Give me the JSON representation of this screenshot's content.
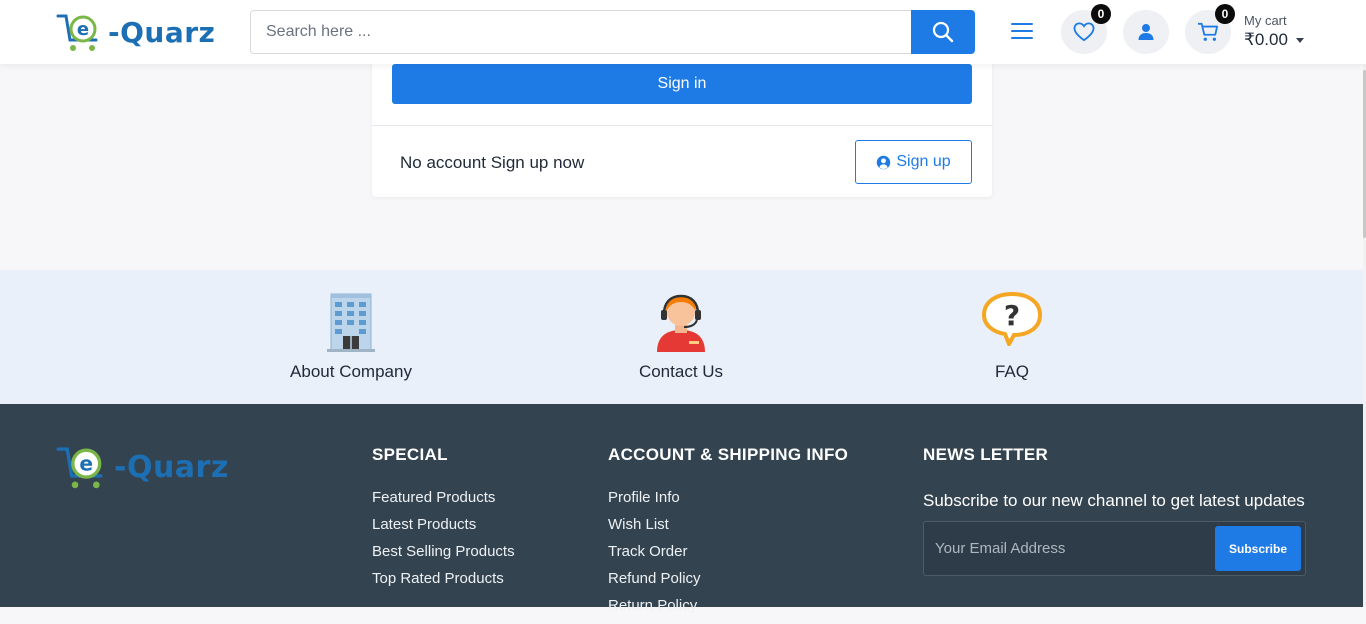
{
  "header": {
    "logo_text": "-Quarz",
    "logo_letter": "e",
    "search": {
      "placeholder": "Search here ..."
    },
    "wishlist_count": "0",
    "cart_count": "0",
    "cart_label": "My cart",
    "cart_total": "₹0.00"
  },
  "auth": {
    "signin_label": "Sign in",
    "no_account_text": "No account Sign up now",
    "signup_label": "Sign up"
  },
  "info": {
    "items": [
      {
        "label": "About Company",
        "icon": "building-icon"
      },
      {
        "label": "Contact Us",
        "icon": "support-agent-icon"
      },
      {
        "label": "FAQ",
        "icon": "question-bubble-icon"
      }
    ]
  },
  "footer": {
    "logo_text": "-Quarz",
    "logo_letter": "e",
    "special": {
      "title": "SPECIAL",
      "items": [
        "Featured Products",
        "Latest Products",
        "Best Selling Products",
        "Top Rated Products"
      ]
    },
    "account": {
      "title": "ACCOUNT & SHIPPING INFO",
      "items": [
        "Profile Info",
        "Wish List",
        "Track Order",
        "Refund Policy",
        "Return Policy"
      ]
    },
    "newsletter": {
      "title": "NEWS LETTER",
      "subtitle": "Subscribe to our new channel to get latest updates",
      "email_placeholder": "Your Email Address",
      "subscribe_label": "Subscribe"
    }
  },
  "colors": {
    "accent": "#1e7be6",
    "footer_bg": "#33434f",
    "info_band_bg": "#e9f0fa",
    "logo_blue": "#1d6fb4",
    "logo_green": "#7ab648"
  }
}
